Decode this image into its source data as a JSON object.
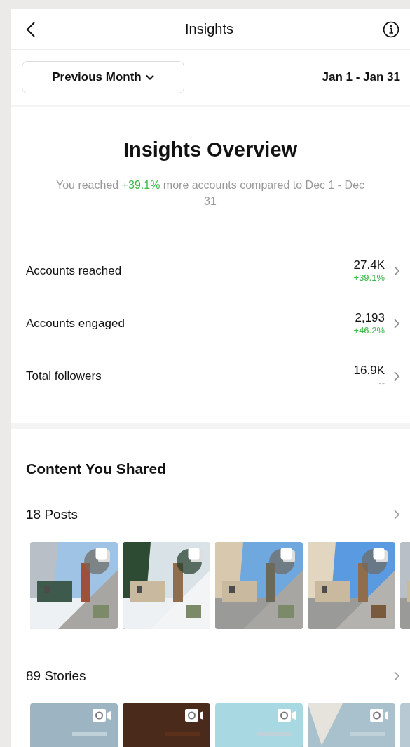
{
  "header": {
    "title": "Insights"
  },
  "filter": {
    "period": "Previous Month",
    "date_range": "Jan 1 - Jan 31"
  },
  "overview": {
    "title": "Insights Overview",
    "summary_before": "You reached ",
    "summary_highlight": "+39.1%",
    "summary_after": " more accounts compared to Dec 1 - Dec 31",
    "metrics": [
      {
        "label": "Accounts reached",
        "value": "27.4K",
        "change": "+39.1%",
        "kind": "up"
      },
      {
        "label": "Accounts engaged",
        "value": "2,193",
        "change": "+46.2%",
        "kind": "up"
      },
      {
        "label": "Total followers",
        "value": "16.9K",
        "change": "--",
        "kind": "none"
      }
    ]
  },
  "content": {
    "title": "Content You Shared",
    "groups": [
      {
        "label": "18 Posts",
        "kind": "posts",
        "thumbnails": [
          {
            "kind": "picture"
          },
          {
            "kind": "picture"
          },
          {
            "kind": "picture"
          },
          {
            "kind": "picture"
          },
          {
            "kind": "partial"
          }
        ]
      },
      {
        "label": "89 Stories",
        "kind": "stories",
        "thumbnails": [
          {
            "kind": "picture"
          },
          {
            "kind": "picture"
          },
          {
            "kind": "picture"
          },
          {
            "kind": "picture"
          },
          {
            "kind": "partial"
          }
        ]
      }
    ]
  }
}
